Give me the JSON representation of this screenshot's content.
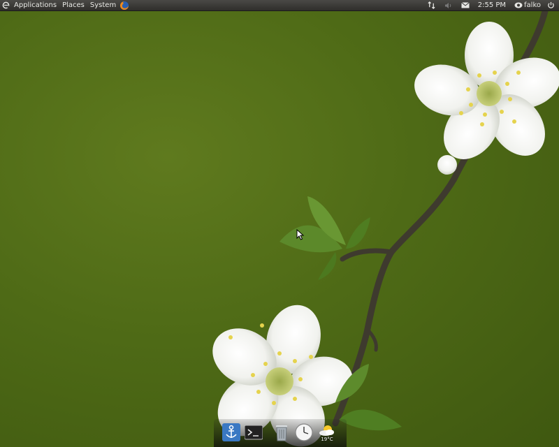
{
  "panel": {
    "menus": [
      "Applications",
      "Places",
      "System"
    ],
    "clock": "2:55 PM",
    "username": "falko"
  },
  "icons": {
    "distro_logo": "ubuntu-logo-icon",
    "browser": "firefox-icon",
    "network": "network-transfer-icon",
    "volume": "volume-icon",
    "mail": "mail-icon",
    "user_status": "user-status-icon",
    "power": "power-icon"
  },
  "dock": {
    "items": [
      "anchor-icon",
      "terminal-icon",
      "trash-icon",
      "clock-icon",
      "weather-icon"
    ],
    "weather_temp": "19°C"
  },
  "colors": {
    "panel": "#3a3936",
    "wallpaper": "#4e6a16",
    "dock_anchor": "#3a78c3"
  }
}
